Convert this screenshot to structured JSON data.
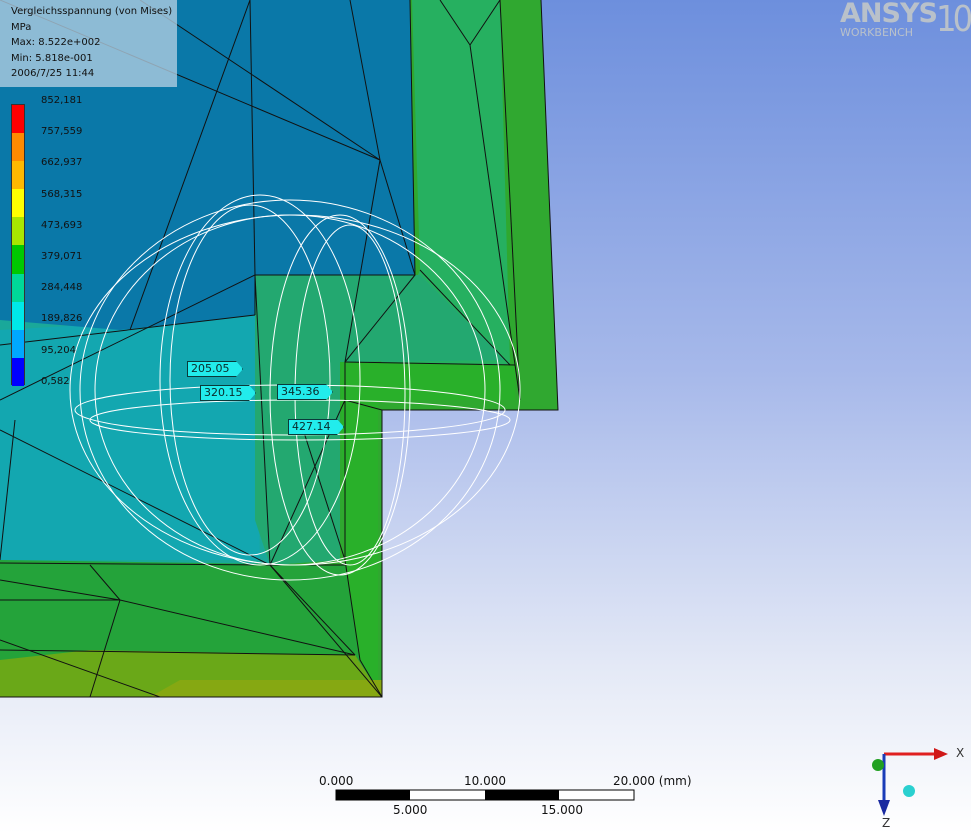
{
  "result": {
    "title": "Vergleichsspannung (von Mises)",
    "unit": "MPa",
    "max": "Max: 8.522e+002",
    "min": "Min: 5.818e-001",
    "timestamp": "2006/7/25 11:44"
  },
  "legend": {
    "ticks": [
      "852,181",
      "757,559",
      "662,937",
      "568,315",
      "473,693",
      "379,071",
      "284,448",
      "189,826",
      "95,204",
      "0,582"
    ],
    "colors": [
      "#ff0000",
      "#ff8a00",
      "#ffb800",
      "#ffff00",
      "#a8e600",
      "#00c800",
      "#00d898",
      "#00e8e8",
      "#00a8ff",
      "#0000ff"
    ]
  },
  "probes": [
    {
      "value": "205.05"
    },
    {
      "value": "320.15"
    },
    {
      "value": "345.36"
    },
    {
      "value": "427.14"
    }
  ],
  "logo": {
    "name": "ANSYS",
    "version": "10.0",
    "product": "WORKBENCH"
  },
  "scale_bar": {
    "top_labels": [
      "0.000",
      "10.000",
      "20.000 (mm)"
    ],
    "bottom_labels": [
      "5.000",
      "15.000"
    ]
  },
  "triad": {
    "x_label": "X",
    "z_label": "Z"
  }
}
